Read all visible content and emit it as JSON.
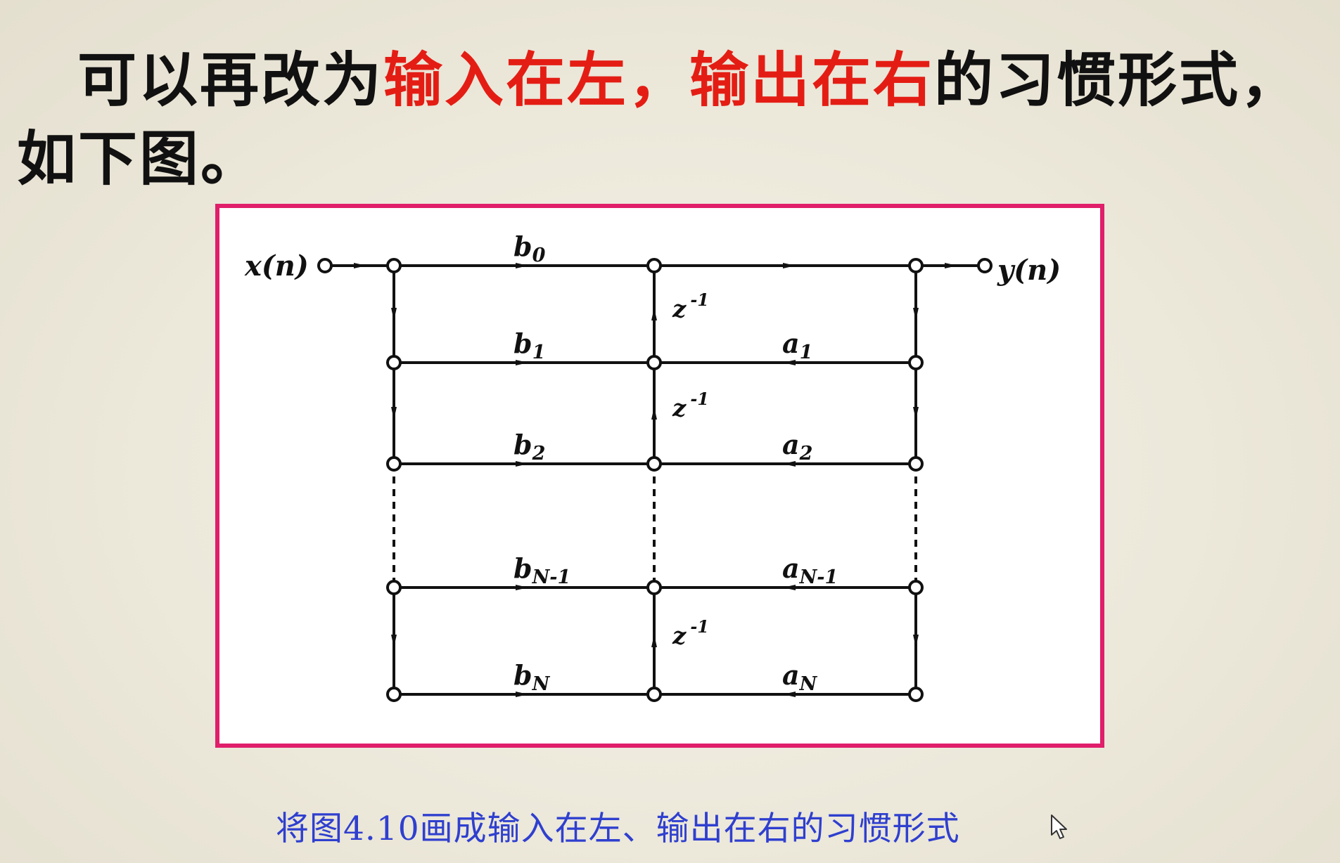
{
  "heading": {
    "part1": "可以再改为",
    "part2": "输入在左，输出在右",
    "part3": "的习惯形式，如下图。"
  },
  "diagram": {
    "input_label": "x(n)",
    "output_label": "y(n)",
    "rows": [
      {
        "b": "b",
        "b_sub": "0",
        "a": "",
        "a_sub": "",
        "dashed_above": false
      },
      {
        "b": "b",
        "b_sub": "1",
        "a": "a",
        "a_sub": "1",
        "dashed_above": false
      },
      {
        "b": "b",
        "b_sub": "2",
        "a": "a",
        "a_sub": "2",
        "dashed_above": false
      },
      {
        "b": "b",
        "b_sub": "N-1",
        "a": "a",
        "a_sub": "N-1",
        "dashed_above": true
      },
      {
        "b": "b",
        "b_sub": "N",
        "a": "a",
        "a_sub": "N",
        "dashed_above": false
      }
    ],
    "delay": {
      "base": "z",
      "exp": "-1"
    }
  },
  "caption": "将图4.10画成输入在左、输出在右的习惯形式",
  "colors": {
    "highlight": "#e41d14",
    "frame": "#e01e6a",
    "caption": "#2f3fcf"
  },
  "icons": {
    "cursor": "mouse-pointer-icon"
  }
}
